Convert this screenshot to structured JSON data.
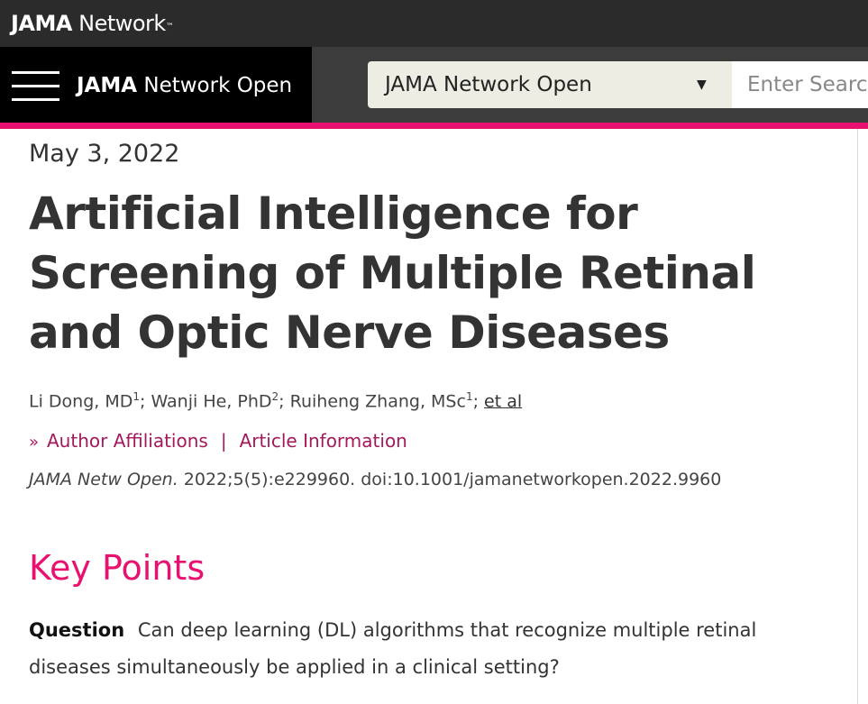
{
  "topbar": {
    "brand_bold": "JAMA",
    "brand_regular": "Network",
    "brand_tm": "™"
  },
  "journalbar": {
    "journal_bold": "JAMA",
    "journal_regular": "Network Open",
    "select_value": "JAMA Network Open",
    "search_placeholder": "Enter Search Term",
    "accent_color": "#e8116f"
  },
  "article": {
    "date": "May 3, 2022",
    "title": "Artificial Intelligence for Screening of Multiple Retinal and Optic Nerve Diseases",
    "authors": [
      {
        "name": "Li Dong, MD",
        "sup": "1",
        "sep": "; "
      },
      {
        "name": "Wanji He, PhD",
        "sup": "2",
        "sep": "; "
      },
      {
        "name": "Ruiheng Zhang, MSc",
        "sup": "1",
        "sep": "; "
      }
    ],
    "et_al": "et al",
    "author_affiliations": "Author Affiliations",
    "link_separator": "|",
    "article_information": "Article Information",
    "citation_journal": "JAMA Netw Open.",
    "citation_rest": " 2022;5(5):e229960. doi:10.1001/jamanetworkopen.2022.9960"
  },
  "key_points": {
    "heading": "Key Points",
    "question_label": "Question",
    "question_text": "Can deep learning (DL) algorithms that recognize multiple retinal diseases simultaneously be applied in a clinical setting?"
  }
}
